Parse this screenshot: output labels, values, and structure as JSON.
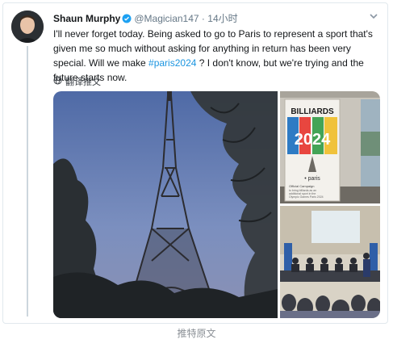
{
  "tweet": {
    "author_name": "Shaun Murphy",
    "handle": "@Magician147",
    "separator": "·",
    "time": "14小时",
    "text_before_hashtag": "I'll never forget today. Being asked to go to Paris to represent a sport that's given me so much without asking for anything in return has been very special. Will we make ",
    "hashtag": "#paris2024",
    "text_after_hashtag": " ? I don't know, but we're trying and the future starts now.",
    "translate_label": "翻译推文",
    "banner": {
      "title": "BILLIARDS",
      "year": "2024",
      "city": "• paris",
      "sub_line1": "Official Campaign",
      "sub_line2": "to bring billiards as an",
      "sub_line3": "additional sport in the",
      "sub_line4": "Olympic Games Paris 2024"
    }
  },
  "caption": "推特原文",
  "colors": {
    "accent": "#1b95e0",
    "verified": "#1da1f2",
    "border": "#e1e8ed",
    "muted": "#657786"
  },
  "icons": [
    "verified-badge-icon",
    "chevron-down-icon",
    "globe-icon"
  ]
}
